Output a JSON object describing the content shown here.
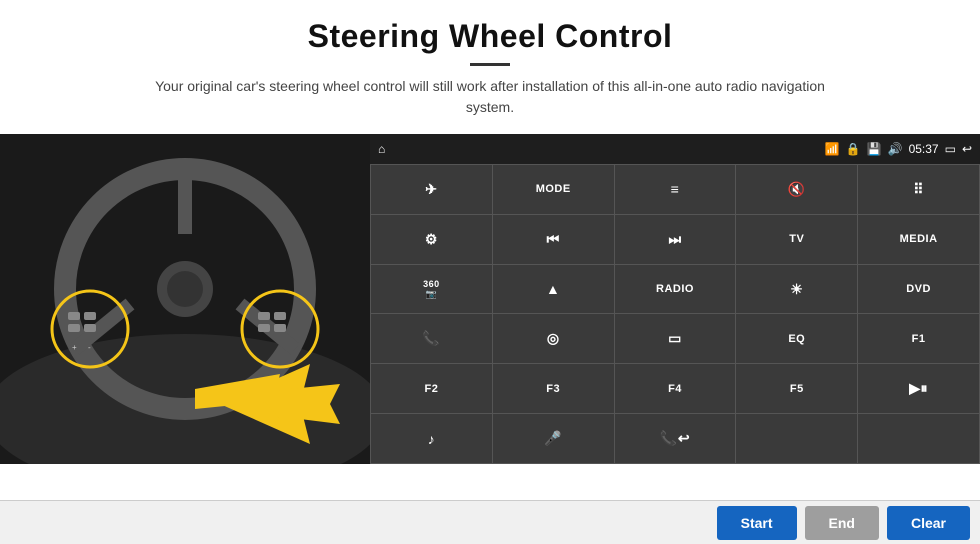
{
  "header": {
    "title": "Steering Wheel Control",
    "subtitle": "Your original car's steering wheel control will still work after installation of this all-in-one auto radio navigation system."
  },
  "status_bar": {
    "home_icon": "⌂",
    "wifi_icon": "📶",
    "lock_icon": "🔒",
    "sd_icon": "💾",
    "bt_icon": "🔊",
    "time": "05:37",
    "screen_icon": "▭",
    "back_icon": "↩"
  },
  "buttons": [
    {
      "label": "✈",
      "row": 1,
      "col": 1
    },
    {
      "label": "MODE",
      "row": 1,
      "col": 2
    },
    {
      "label": "☰",
      "row": 1,
      "col": 3
    },
    {
      "label": "🔇",
      "row": 1,
      "col": 4
    },
    {
      "label": "⋯",
      "row": 1,
      "col": 5
    },
    {
      "label": "⚙",
      "row": 2,
      "col": 1
    },
    {
      "label": "⏮",
      "row": 2,
      "col": 2
    },
    {
      "label": "⏭",
      "row": 2,
      "col": 3
    },
    {
      "label": "TV",
      "row": 2,
      "col": 4
    },
    {
      "label": "MEDIA",
      "row": 2,
      "col": 5
    },
    {
      "label": "360",
      "row": 3,
      "col": 1
    },
    {
      "label": "▲",
      "row": 3,
      "col": 2
    },
    {
      "label": "RADIO",
      "row": 3,
      "col": 3
    },
    {
      "label": "☀",
      "row": 3,
      "col": 4
    },
    {
      "label": "DVD",
      "row": 3,
      "col": 5
    },
    {
      "label": "📞",
      "row": 4,
      "col": 1
    },
    {
      "label": "🌀",
      "row": 4,
      "col": 2
    },
    {
      "label": "▭",
      "row": 4,
      "col": 3
    },
    {
      "label": "EQ",
      "row": 4,
      "col": 4
    },
    {
      "label": "F1",
      "row": 4,
      "col": 5
    },
    {
      "label": "F2",
      "row": 5,
      "col": 1
    },
    {
      "label": "F3",
      "row": 5,
      "col": 2
    },
    {
      "label": "F4",
      "row": 5,
      "col": 3
    },
    {
      "label": "F5",
      "row": 5,
      "col": 4
    },
    {
      "label": "▶⏸",
      "row": 5,
      "col": 5
    },
    {
      "label": "♪",
      "row": 6,
      "col": 1
    },
    {
      "label": "🎤",
      "row": 6,
      "col": 2
    },
    {
      "label": "📞↩",
      "row": 6,
      "col": 3
    },
    {
      "label": "",
      "row": 6,
      "col": 4
    },
    {
      "label": "",
      "row": 6,
      "col": 5
    }
  ],
  "bottom_bar": {
    "start_label": "Start",
    "end_label": "End",
    "clear_label": "Clear"
  }
}
